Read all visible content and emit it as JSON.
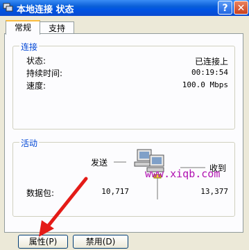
{
  "window": {
    "title": "本地连接 状态",
    "help": "?",
    "close": "✕"
  },
  "tabs": [
    {
      "label": "常规"
    },
    {
      "label": "支持"
    }
  ],
  "connection": {
    "legend": "连接",
    "rows": [
      {
        "label": "状态:",
        "value": "已连接上"
      },
      {
        "label": "持续时间:",
        "value": "00:19:54"
      },
      {
        "label": "速度:",
        "value": "100.0 Mbps"
      }
    ]
  },
  "activity": {
    "legend": "活动",
    "sent_label": "发送",
    "received_label": "收到",
    "packets_label": "数据包:",
    "sent_value": "10,717",
    "received_value": "13,377"
  },
  "watermark": "www.xiqb.com",
  "buttons": {
    "properties": "属性(P)",
    "disable": "禁用(D)"
  },
  "colors": {
    "titlebar": "#0054e3",
    "annotation_arrow": "#e41b17",
    "watermark": "#b010b0"
  }
}
